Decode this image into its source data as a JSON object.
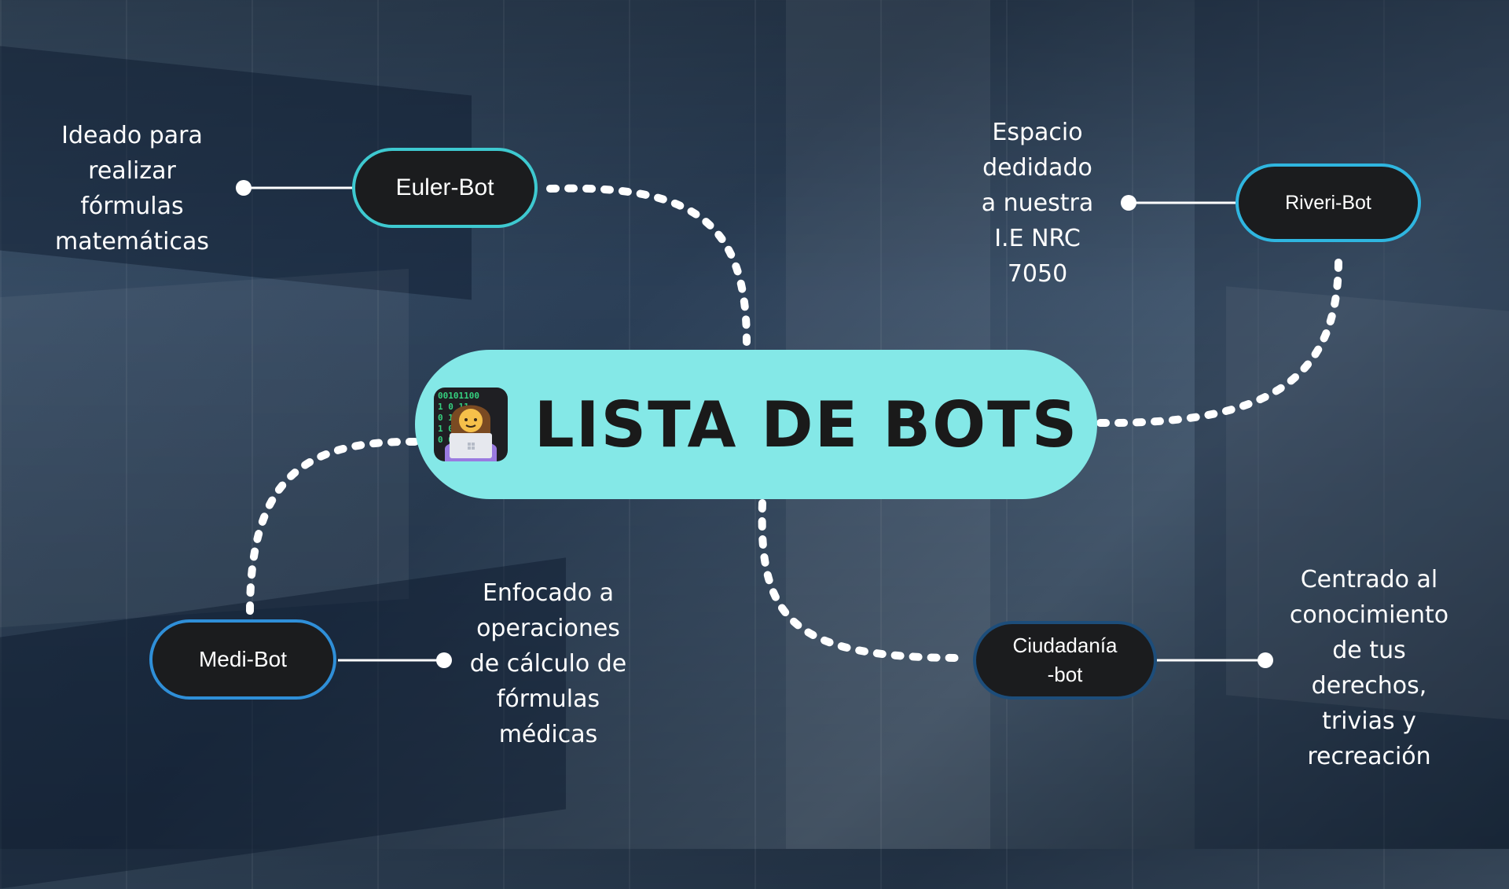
{
  "title": "LISTA DE BOTS",
  "icon": "technologist-woman-icon",
  "colors": {
    "center_pill": "#84e8e7",
    "node_fill": "#1b1c1e",
    "border_teal": "#3ec9d0",
    "border_blue": "#2f8fd8",
    "border_navy": "#1d4d7a",
    "connector": "#ffffff"
  },
  "nodes": {
    "euler": {
      "label": "Euler-Bot",
      "description": [
        "Ideado para",
        "realizar",
        "fórmulas",
        "matemáticas"
      ]
    },
    "riveri": {
      "label": "Riveri-Bot",
      "description": [
        "Espacio",
        "dedidado",
        "a nuestra",
        "I.E NRC",
        "7050"
      ]
    },
    "medi": {
      "label": "Medi-Bot",
      "description": [
        "Enfocado a",
        "operaciones",
        "de cálculo de",
        "fórmulas",
        "médicas"
      ]
    },
    "ciudadania": {
      "label": [
        "Ciudadanía",
        "-bot"
      ],
      "description": [
        "Centrado al",
        "conocimiento",
        "de tus",
        "derechos,",
        "trivias y",
        "recreación"
      ]
    }
  }
}
